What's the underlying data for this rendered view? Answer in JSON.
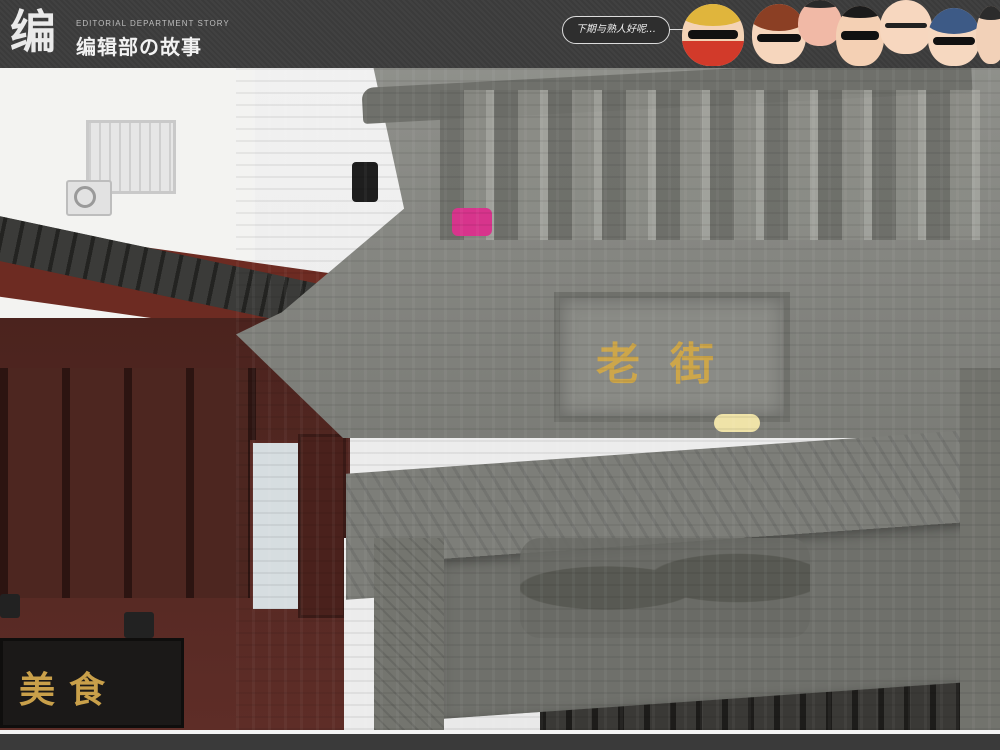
{
  "header": {
    "logo_mark": "编",
    "logo_en": "EDITORIAL DEPARTMENT STORY",
    "logo_cn": "编辑部の故事",
    "bubble_text": "下期与熟人好呢…",
    "avatars": [
      {
        "name": "avatar-bandana",
        "icon": "face-icon"
      },
      {
        "name": "avatar-brown-hair",
        "icon": "face-icon"
      },
      {
        "name": "avatar-red-face",
        "icon": "face-icon"
      },
      {
        "name": "avatar-glasses-man",
        "icon": "face-icon"
      },
      {
        "name": "avatar-bald-man",
        "icon": "face-icon"
      },
      {
        "name": "avatar-blue-hair",
        "icon": "face-icon"
      },
      {
        "name": "avatar-edge",
        "icon": "face-icon"
      }
    ]
  },
  "photo": {
    "plaque_text": "老街",
    "sign_text": "美食"
  },
  "colors": {
    "header_bg": "#3b3b3b",
    "stone": "#7d7e79",
    "gold": "#cda64a",
    "wood": "#5a2a24"
  }
}
